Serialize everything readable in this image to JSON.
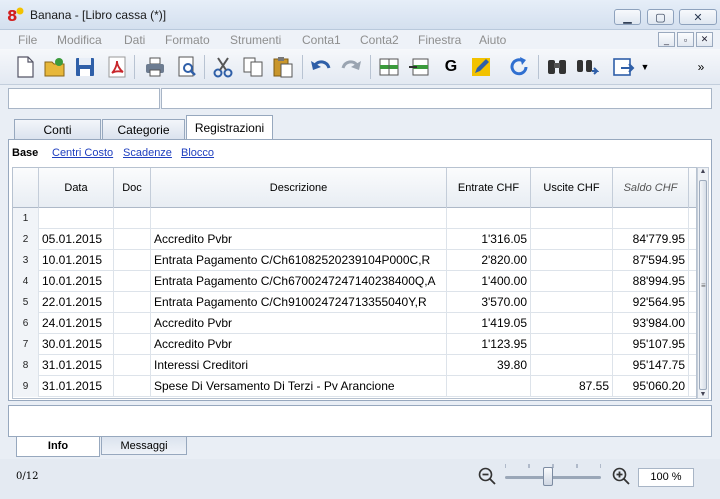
{
  "window": {
    "title": "Banana - [Libro cassa (*)]",
    "app_icon": "banana-icon"
  },
  "menu": {
    "items": [
      "File",
      "Modifica",
      "Dati",
      "Formato",
      "Strumenti",
      "Conta1",
      "Conta2",
      "Finestra",
      "Aiuto"
    ]
  },
  "toolbar": {
    "icons": [
      "new-file-icon",
      "open-file-icon",
      "save-icon",
      "pdf-icon",
      "print-icon",
      "print-preview-icon",
      "cut-icon",
      "copy-icon",
      "paste-icon",
      "undo-icon",
      "redo-icon",
      "insert-row-icon",
      "delete-row-icon",
      "g-icon",
      "edit-icon",
      "recalculate-icon",
      "find-icon",
      "find-next-icon",
      "export-icon"
    ],
    "g_label": "G"
  },
  "main_tabs": [
    "Conti",
    "Categorie",
    "Registrazioni"
  ],
  "sub_tabs": [
    "Base",
    "Centri Costo",
    "Scadenze",
    "Blocco"
  ],
  "table": {
    "headers": [
      "Data",
      "Doc",
      "Descrizione",
      "Entrate CHF",
      "Uscite CHF",
      "Saldo CHF"
    ],
    "rows": [
      {
        "n": "1",
        "data": "",
        "doc": "",
        "desc": "",
        "entrate": "",
        "uscite": "",
        "saldo": ""
      },
      {
        "n": "2",
        "data": "05.01.2015",
        "doc": "",
        "desc": "Accredito Pvbr",
        "entrate": "1'316.05",
        "uscite": "",
        "saldo": "84'779.95"
      },
      {
        "n": "3",
        "data": "10.01.2015",
        "doc": "",
        "desc": "Entrata Pagamento C/Ch61082520239104P000C,R",
        "entrate": "2'820.00",
        "uscite": "",
        "saldo": "87'594.95"
      },
      {
        "n": "4",
        "data": "10.01.2015",
        "doc": "",
        "desc": "Entrata Pagamento C/Ch6700247247140238400Q,A",
        "entrate": "1'400.00",
        "uscite": "",
        "saldo": "88'994.95"
      },
      {
        "n": "5",
        "data": "22.01.2015",
        "doc": "",
        "desc": "Entrata Pagamento C/Ch910024724713355040Y,R",
        "entrate": "3'570.00",
        "uscite": "",
        "saldo": "92'564.95"
      },
      {
        "n": "6",
        "data": "24.01.2015",
        "doc": "",
        "desc": "Accredito Pvbr",
        "entrate": "1'419.05",
        "uscite": "",
        "saldo": "93'984.00"
      },
      {
        "n": "7",
        "data": "30.01.2015",
        "doc": "",
        "desc": "Accredito Pvbr",
        "entrate": "1'123.95",
        "uscite": "",
        "saldo": "95'107.95"
      },
      {
        "n": "8",
        "data": "31.01.2015",
        "doc": "",
        "desc": "Interessi Creditori",
        "entrate": "39.80",
        "uscite": "",
        "saldo": "95'147.75"
      },
      {
        "n": "9",
        "data": "31.01.2015",
        "doc": "",
        "desc": "Spese Di Versamento Di Terzi - Pv Arancione",
        "entrate": "",
        "uscite": "87.55",
        "saldo": "95'060.20"
      }
    ]
  },
  "bottom_tabs": [
    "Info",
    "Messaggi"
  ],
  "status": {
    "counter": "0/12",
    "zoom": "100 %",
    "zoom_level_fraction": 0.45
  },
  "colors": {
    "accent_blue": "#1f3fbf",
    "toolbar_bg": "#e3e9f2",
    "pdf_red": "#c8262b"
  }
}
